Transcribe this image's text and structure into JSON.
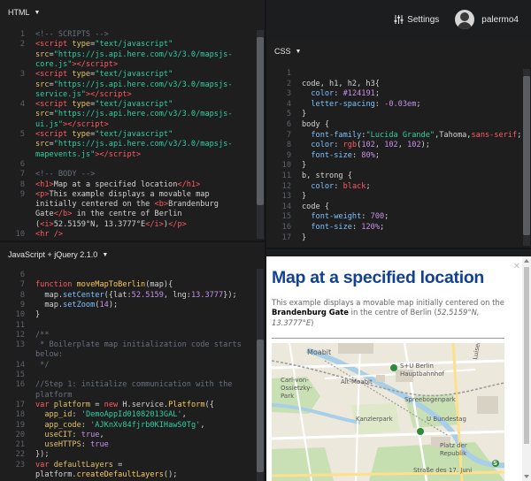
{
  "html_panel": {
    "title": "HTML",
    "lines": [
      {
        "n": "1",
        "html": "<span class='c'>&lt;!-- SCRIPTS --&gt;</span>"
      },
      {
        "n": "2",
        "html": "<span class='t'>&lt;script</span> <span class='a'>type</span>=<span class='s'>\"text/javascript\"</span>"
      },
      {
        "n": "",
        "html": "<span class='a'>src</span>=<span class='s'>\"https://js.api.here.com/v3/3.0/mapsjs-</span>"
      },
      {
        "n": "",
        "html": "<span class='s'>core.js\"</span><span class='t'>&gt;&lt;/script&gt;</span>"
      },
      {
        "n": "3",
        "html": "<span class='t'>&lt;script</span> <span class='a'>type</span>=<span class='s'>\"text/javascript\"</span>"
      },
      {
        "n": "",
        "html": "<span class='a'>src</span>=<span class='s'>\"https://js.api.here.com/v3/3.0/mapsjs-</span>"
      },
      {
        "n": "",
        "html": "<span class='s'>service.js\"</span><span class='t'>&gt;&lt;/script&gt;</span>"
      },
      {
        "n": "4",
        "html": "<span class='t'>&lt;script</span> <span class='a'>type</span>=<span class='s'>\"text/javascript\"</span>"
      },
      {
        "n": "",
        "html": "<span class='a'>src</span>=<span class='s'>\"https://js.api.here.com/v3/3.0/mapsjs-</span>"
      },
      {
        "n": "",
        "html": "<span class='s'>ui.js\"</span><span class='t'>&gt;&lt;/script&gt;</span>"
      },
      {
        "n": "5",
        "html": "<span class='t'>&lt;script</span> <span class='a'>type</span>=<span class='s'>\"text/javascript\"</span>"
      },
      {
        "n": "",
        "html": "<span class='a'>src</span>=<span class='s'>\"https://js.api.here.com/v3/3.0/mapsjs-</span>"
      },
      {
        "n": "",
        "html": "<span class='s'>mapevents.js\"</span><span class='t'>&gt;&lt;/script&gt;</span>"
      },
      {
        "n": "6",
        "html": ""
      },
      {
        "n": "7",
        "html": "<span class='c'>&lt;!-- BODY --&gt;</span>"
      },
      {
        "n": "8",
        "html": "<span class='t'>&lt;h1&gt;</span>Map at a specified location<span class='t'>&lt;/h1&gt;</span>"
      },
      {
        "n": "9",
        "html": "<span class='t'>&lt;p&gt;</span>This example displays a movable map"
      },
      {
        "n": "",
        "html": "initially centered on the <span class='t'>&lt;b&gt;</span>Brandenburg"
      },
      {
        "n": "",
        "html": "Gate<span class='t'>&lt;/b&gt;</span> in the centre of Berlin"
      },
      {
        "n": "",
        "html": "(<span class='t'>&lt;i&gt;</span>52.5159°N, 13.3777°E<span class='t'>&lt;/i&gt;</span>)<span class='t'>&lt;/p&gt;</span>"
      },
      {
        "n": "10",
        "html": "<span class='t'>&lt;hr /&gt;</span>"
      }
    ]
  },
  "css_panel": {
    "title": "CSS",
    "lines": [
      {
        "n": "1",
        "html": ""
      },
      {
        "n": "2",
        "html": "<span class='w'>code, h1, h2, h3{</span>"
      },
      {
        "n": "3",
        "html": "  <span class='p'>color</span>: <span class='n'>#124191</span>;"
      },
      {
        "n": "4",
        "html": "  <span class='p'>letter-spacing</span>: <span class='n'>-0.03em</span>;"
      },
      {
        "n": "5",
        "html": "}"
      },
      {
        "n": "6",
        "html": "<span class='w'>body {</span>"
      },
      {
        "n": "7",
        "html": "  <span class='p'>font-family</span>:<span class='s'>\"Lucida Grande\"</span>,Tahoma,<span class='k'>sans-serif</span>;"
      },
      {
        "n": "8",
        "html": "  <span class='p'>color</span>: <span class='k'>rgb</span>(<span class='n'>102</span>, <span class='n'>102</span>, <span class='n'>102</span>);"
      },
      {
        "n": "9",
        "html": "  <span class='p'>font-size</span>: <span class='n'>80%</span>;"
      },
      {
        "n": "10",
        "html": "}"
      },
      {
        "n": "11",
        "html": "<span class='w'>b, strong {</span>"
      },
      {
        "n": "12",
        "html": "  <span class='p'>color</span>: <span class='k'>black</span>;"
      },
      {
        "n": "13",
        "html": "}"
      },
      {
        "n": "14",
        "html": "<span class='w'>code {</span>"
      },
      {
        "n": "15",
        "html": "  <span class='p'>font-weight</span>: <span class='n'>700</span>;"
      },
      {
        "n": "16",
        "html": "  <span class='p'>font-size</span>: <span class='n'>120%</span>;"
      },
      {
        "n": "17",
        "html": "}"
      }
    ]
  },
  "js_panel": {
    "title": "JavaScript + jQuery 2.1.0",
    "lines": [
      {
        "n": "6",
        "html": ""
      },
      {
        "n": "7",
        "html": "<span class='k'>function</span> <span class='f'>moveMapToBerlin</span>(map){"
      },
      {
        "n": "8",
        "html": "  map.<span class='p'>setCenter</span>({lat:<span class='n'>52.5159</span>, lng:<span class='n'>13.3777</span>});"
      },
      {
        "n": "9",
        "html": "  map.<span class='p'>setZoom</span>(<span class='n'>14</span>);"
      },
      {
        "n": "10",
        "html": "}"
      },
      {
        "n": "11",
        "html": ""
      },
      {
        "n": "12",
        "html": "<span class='c'>/**</span>"
      },
      {
        "n": "13",
        "html": "<span class='c'> * Boilerplate map initialization code starts</span>"
      },
      {
        "n": "",
        "html": "<span class='c'>below:</span>"
      },
      {
        "n": "14",
        "html": "<span class='c'> */</span>"
      },
      {
        "n": "15",
        "html": ""
      },
      {
        "n": "16",
        "html": "<span class='c'>//Step 1: initialize communication with the</span>"
      },
      {
        "n": "",
        "html": "<span class='c'>platform</span>"
      },
      {
        "n": "17",
        "html": "<span class='k'>var</span> <span class='v'>platform</span> = <span class='k'>new</span> H.service.<span class='f'>Platform</span>({"
      },
      {
        "n": "18",
        "html": "  <span class='a'>app_id</span>: <span class='s'>'DemoAppId01082013GAL'</span>,"
      },
      {
        "n": "19",
        "html": "  <span class='a'>app_code</span>: <span class='s'>'AJKnXv84fjrb0KIHawS0Tg'</span>,"
      },
      {
        "n": "20",
        "html": "  <span class='a'>useCIT</span>: <span class='n'>true</span>,"
      },
      {
        "n": "21",
        "html": "  <span class='a'>useHTTPS</span>: <span class='n'>true</span>"
      },
      {
        "n": "22",
        "html": "});"
      },
      {
        "n": "23",
        "html": "<span class='k'>var</span> <span class='v'>defaultLayers</span> ="
      },
      {
        "n": "",
        "html": "platform.<span class='f'>createDefaultLayers</span>();"
      }
    ]
  },
  "topbar": {
    "settings_label": "Settings",
    "username": "palermo4"
  },
  "result": {
    "heading": "Map at a specified location",
    "intro": "This example displays a movable map initially centered on the ",
    "bold": "Brandenburg Gate",
    "middle": " in the centre of Berlin (",
    "coords": "52.5159°N, 13.3777°E",
    "end": ")",
    "map_labels": [
      {
        "text": "Moabit"
      },
      {
        "text": "S+U Berlin"
      },
      {
        "text": "Hauptbahnhof"
      },
      {
        "text": "Carl-von-"
      },
      {
        "text": "Ossietzky-"
      },
      {
        "text": "Park"
      },
      {
        "text": "Alt-Moabit"
      },
      {
        "text": "Spreebogenpark"
      },
      {
        "text": "U Bundestag"
      },
      {
        "text": "Kanzlerpark"
      },
      {
        "text": "Platz der"
      },
      {
        "text": "Republik"
      },
      {
        "text": "Straße des 17. Juni"
      },
      {
        "text": "Luisenstraße"
      },
      {
        "text": "S"
      }
    ]
  },
  "colors": {
    "editor_bg": "#1e1e1e",
    "heading": "#124191",
    "body_text": "#666666"
  }
}
